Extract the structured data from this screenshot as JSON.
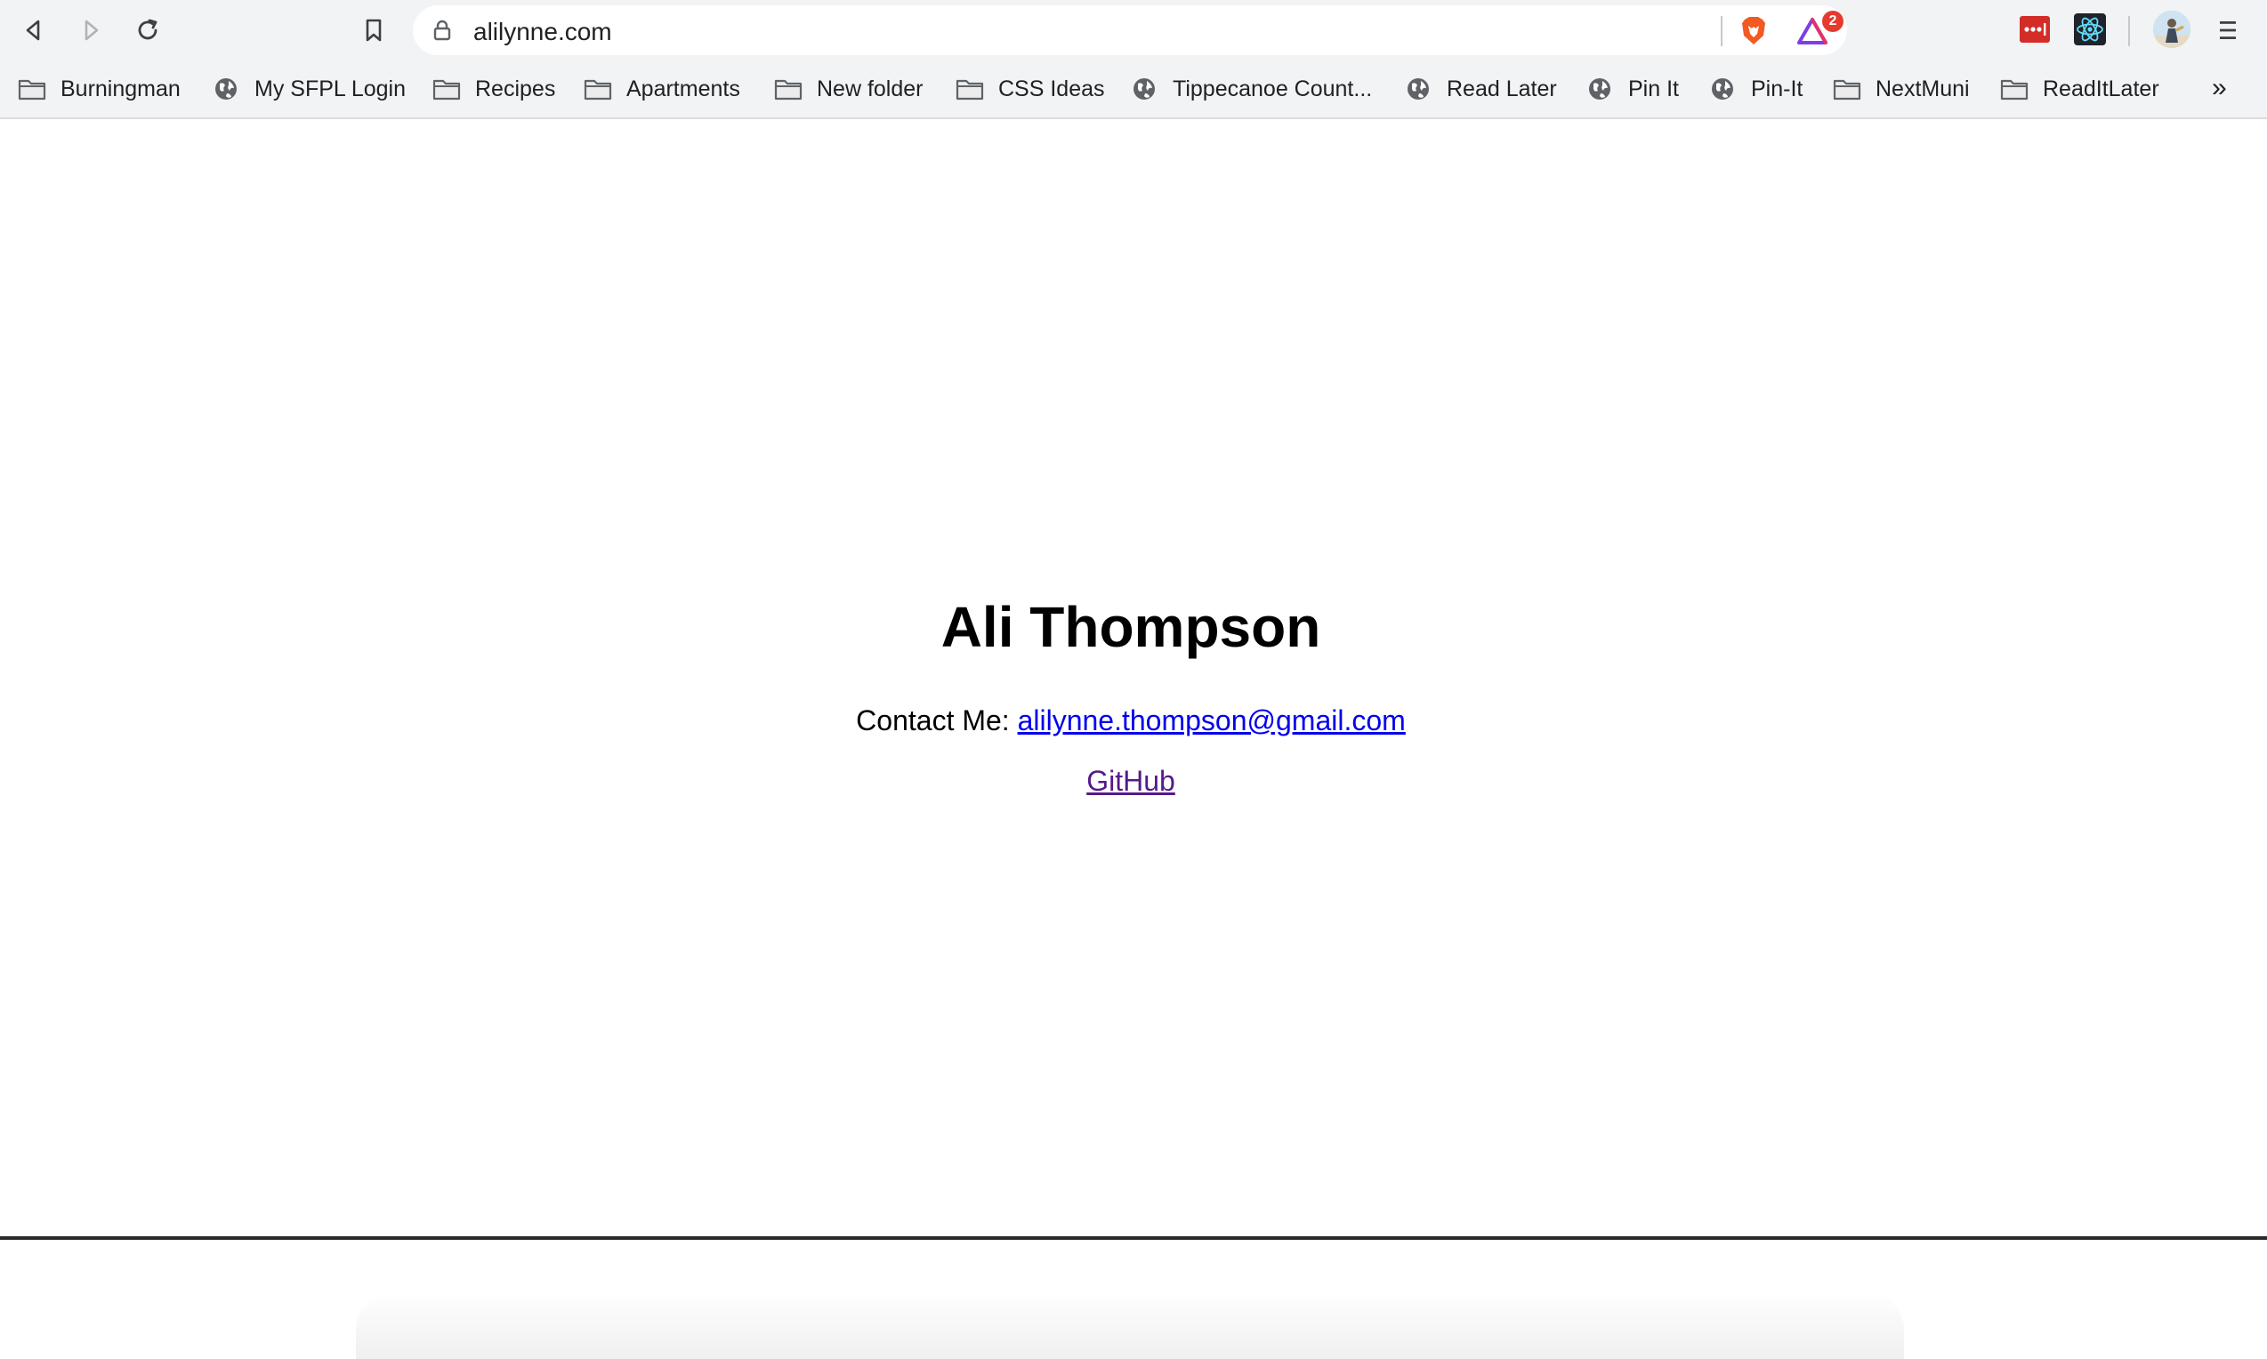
{
  "browser": {
    "url": "alilynne.com",
    "rewards_badge_count": "2",
    "colors": {
      "brave_lion": "#f25a22",
      "rewards": "#7b3fe4",
      "lastpass": "#d32d27",
      "react_devtools": "#20232a"
    }
  },
  "bookmarks": [
    {
      "label": "Burningman",
      "icon": "folder-icon"
    },
    {
      "label": "My SFPL Login",
      "icon": "globe-icon"
    },
    {
      "label": "Recipes",
      "icon": "folder-icon"
    },
    {
      "label": "Apartments",
      "icon": "folder-icon"
    },
    {
      "label": "New folder",
      "icon": "folder-icon"
    },
    {
      "label": "CSS Ideas",
      "icon": "folder-icon"
    },
    {
      "label": "Tippecanoe Count...",
      "icon": "globe-icon"
    },
    {
      "label": "Read Later",
      "icon": "globe-icon"
    },
    {
      "label": "Pin It",
      "icon": "globe-icon"
    },
    {
      "label": "Pin-It",
      "icon": "globe-icon"
    },
    {
      "label": "NextMuni",
      "icon": "folder-icon"
    },
    {
      "label": "ReadItLater",
      "icon": "folder-icon"
    }
  ],
  "bookmarks_overflow": "»",
  "page": {
    "name": "Ali Thompson",
    "contact_label": "Contact Me: ",
    "email": "alilynne.thompson@gmail.com",
    "github_label": "GitHub"
  }
}
